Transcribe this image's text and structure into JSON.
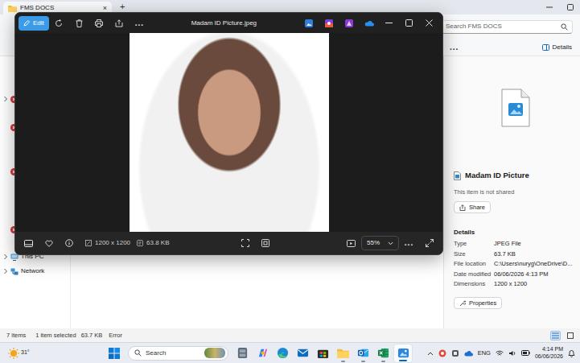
{
  "explorer": {
    "tab": {
      "title": "FMS DOCS",
      "close": "×"
    },
    "new_tab": "+",
    "search": {
      "placeholder": "Search FMS DOCS"
    },
    "command_more": "...",
    "details_button": "Details",
    "nav": [
      {
        "label": "This PC",
        "expanded": false,
        "kind": "computer"
      },
      {
        "label": "Network",
        "expanded": false,
        "kind": "network"
      }
    ],
    "details": {
      "name": "Madam ID Picture",
      "sharing": "This item is not shared",
      "share": "Share",
      "heading": "Details",
      "properties": [
        {
          "label": "Type",
          "value": "JPEG File"
        },
        {
          "label": "Size",
          "value": "63.7 KB"
        },
        {
          "label": "File location",
          "value": "C:\\Users\\nuryg\\OneDrive\\D..."
        },
        {
          "label": "Date modified",
          "value": "06/06/2026 4:13 PM"
        },
        {
          "label": "Dimensions",
          "value": "1200 x 1200"
        }
      ],
      "properties_button": "Properties"
    },
    "status_bar": {
      "count": "7 items",
      "selection": "1 item selected",
      "selection_size": "63.7 KB",
      "error": "Error"
    }
  },
  "viewer": {
    "edit": "Edit",
    "title": "Madam ID Picture.jpeg",
    "more_top": "...",
    "dimensions": "1200 x 1200",
    "file_size": "63.8 KB",
    "zoom": "55%",
    "more_bottom": "..."
  },
  "taskbar": {
    "weather": "31°",
    "search": "Search",
    "language": "ENG",
    "time": "4:14 PM",
    "date": "06/06/2026",
    "apps": [
      {
        "kind": "files",
        "running": false,
        "selected": false
      },
      {
        "kind": "copilot",
        "running": false,
        "selected": false
      },
      {
        "kind": "edge",
        "running": false,
        "selected": false
      },
      {
        "kind": "mail",
        "running": false,
        "selected": false
      },
      {
        "kind": "store",
        "running": false,
        "selected": false
      },
      {
        "kind": "folder",
        "running": true,
        "selected": false
      },
      {
        "kind": "outlook",
        "running": true,
        "selected": false
      },
      {
        "kind": "excel",
        "running": true,
        "selected": false
      },
      {
        "kind": "photos",
        "running": true,
        "selected": true
      }
    ]
  }
}
